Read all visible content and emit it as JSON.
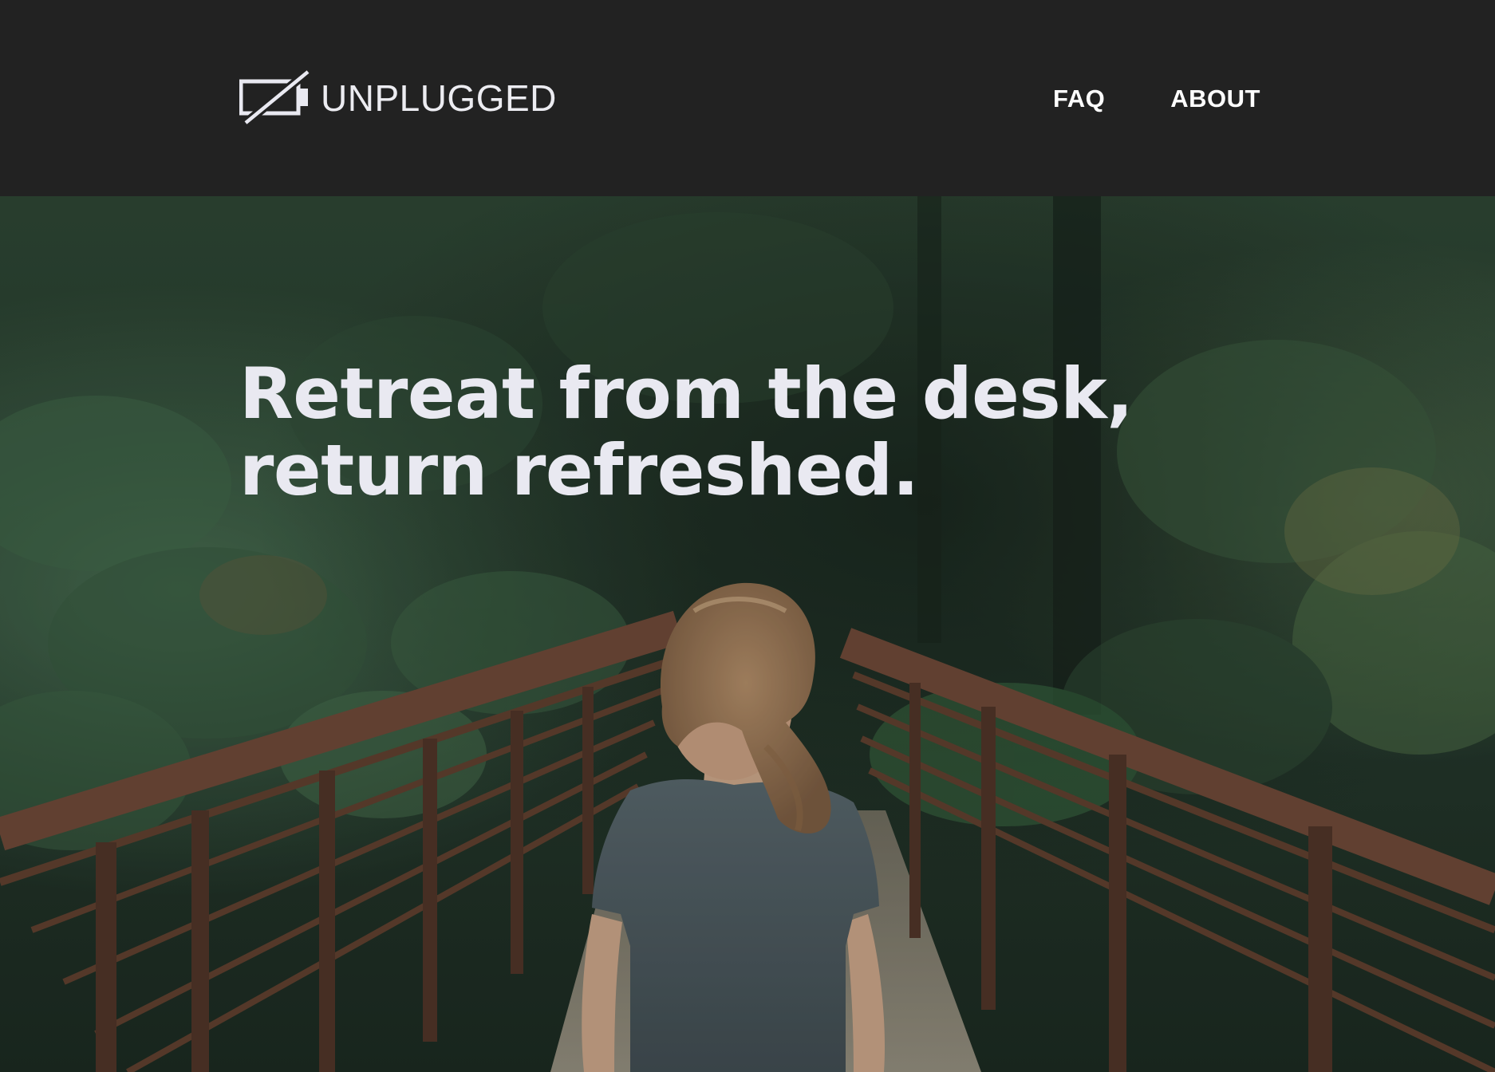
{
  "header": {
    "brand": {
      "name": "UNPLUGGED",
      "icon": "unplugged-battery-icon"
    },
    "nav": [
      {
        "label": "FAQ"
      },
      {
        "label": "ABOUT"
      }
    ]
  },
  "hero": {
    "title_lines": [
      "Retreat from the desk,",
      "return refreshed."
    ],
    "image": "forest-bridge-woman-photo"
  },
  "colors": {
    "header_bg": "#222222",
    "text_light": "#e9e9f1",
    "forest_green": "#2e4a35",
    "bridge_rust": "#6b4434",
    "shirt_gray": "#4a565c"
  }
}
